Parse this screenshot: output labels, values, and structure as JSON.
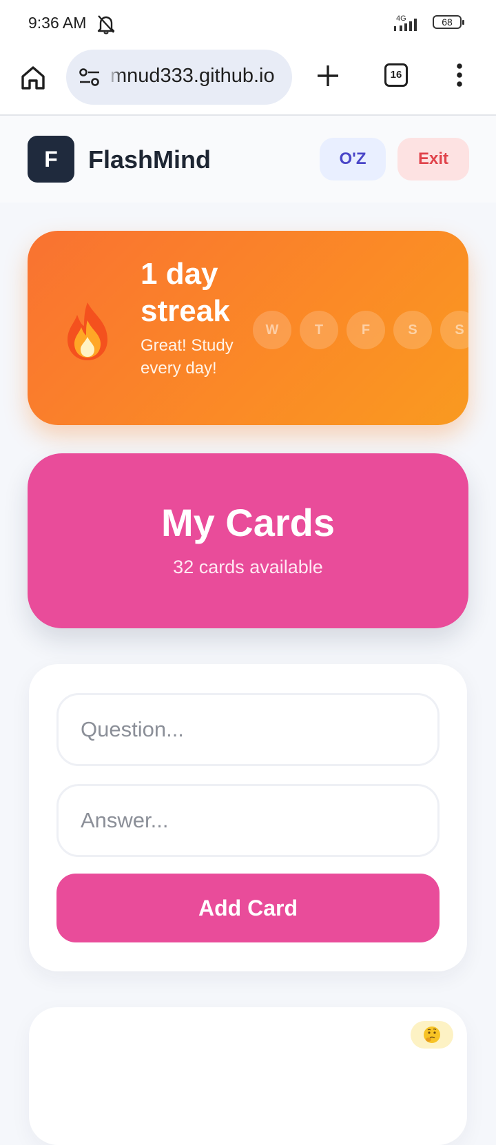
{
  "status": {
    "time": "9:36 AM",
    "network": "4G",
    "battery": "68"
  },
  "browser": {
    "url": "mnud333.github.io",
    "tab_count": "16"
  },
  "header": {
    "logo_letter": "F",
    "brand": "FlashMind",
    "user_label": "O'Z",
    "exit_label": "Exit"
  },
  "streak": {
    "title": "1 day streak",
    "subtitle": "Great! Study every day!",
    "days": [
      "W",
      "T",
      "F",
      "S",
      "S"
    ]
  },
  "cards": {
    "title": "My Cards",
    "count_text": "32 cards available"
  },
  "form": {
    "question_placeholder": "Question...",
    "answer_placeholder": "Answer...",
    "add_label": "Add Card"
  },
  "icons": {
    "status": [
      "bell-off-icon",
      "signal-icon",
      "battery-icon"
    ],
    "browser": [
      "home-icon",
      "site-settings-icon",
      "plus-icon",
      "tabs-icon",
      "menu-icon"
    ],
    "content": [
      "fire-icon",
      "thinking-face-icon"
    ]
  },
  "colors": {
    "accent_pink": "#e94c9a",
    "streak_orange": "#fb8a26",
    "logo_dark": "#1f2a3d",
    "user_text": "#4a46c8",
    "exit_text": "#e0434b"
  }
}
